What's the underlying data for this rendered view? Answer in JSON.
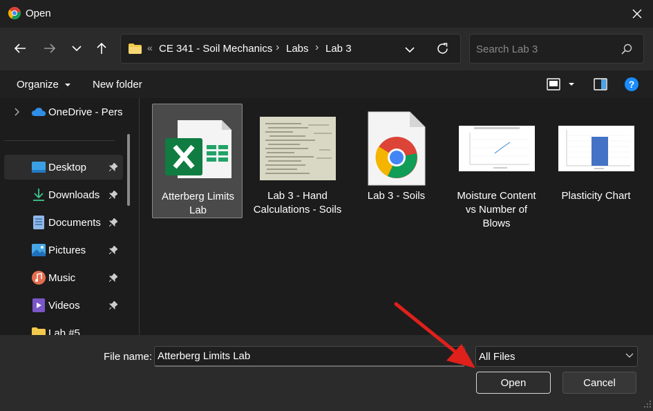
{
  "window": {
    "title": "Open",
    "accent_color": "#0078d4"
  },
  "nav": {
    "back_icon": "arrow-left-icon",
    "forward_icon": "arrow-right-icon",
    "recent_icon": "chevron-down-icon",
    "up_icon": "arrow-up-icon",
    "breadcrumb_overflow": "«",
    "breadcrumbs": [
      "CE 341 - Soil Mechanics",
      "Labs",
      "Lab 3"
    ],
    "refresh_icon": "refresh-icon"
  },
  "search": {
    "placeholder": "Search Lab 3"
  },
  "toolbar": {
    "organize": "Organize",
    "new_folder": "New folder"
  },
  "sidebar": {
    "items": [
      {
        "label": "OneDrive - Personal",
        "icon": "cloud-icon",
        "pinned": false
      },
      {
        "label": "Desktop",
        "icon": "desktop-icon",
        "pinned": true,
        "selected": true
      },
      {
        "label": "Downloads",
        "icon": "download-icon",
        "pinned": true
      },
      {
        "label": "Documents",
        "icon": "document-icon",
        "pinned": true
      },
      {
        "label": "Pictures",
        "icon": "pictures-icon",
        "pinned": true
      },
      {
        "label": "Music",
        "icon": "music-icon",
        "pinned": true
      },
      {
        "label": "Videos",
        "icon": "video-icon",
        "pinned": true
      },
      {
        "label": "Lab #5",
        "icon": "folder-icon",
        "pinned": false
      }
    ]
  },
  "files": [
    {
      "name": "Atterberg Limits Lab",
      "type": "excel",
      "selected": true
    },
    {
      "name": "Lab 3 - Hand Calculations - Soils",
      "type": "image"
    },
    {
      "name": "Lab 3 - Soils",
      "type": "chrome"
    },
    {
      "name": "Moisture Content vs Number of Blows",
      "type": "chart-image"
    },
    {
      "name": "Plasticity Chart",
      "type": "bar-chart-image"
    }
  ],
  "footer": {
    "file_name_label": "File name:",
    "file_name_value": "Atterberg Limits Lab",
    "file_type_value": "All Files",
    "open_label": "Open",
    "cancel_label": "Cancel"
  },
  "annotation": {
    "arrow_color": "#e0201b"
  }
}
